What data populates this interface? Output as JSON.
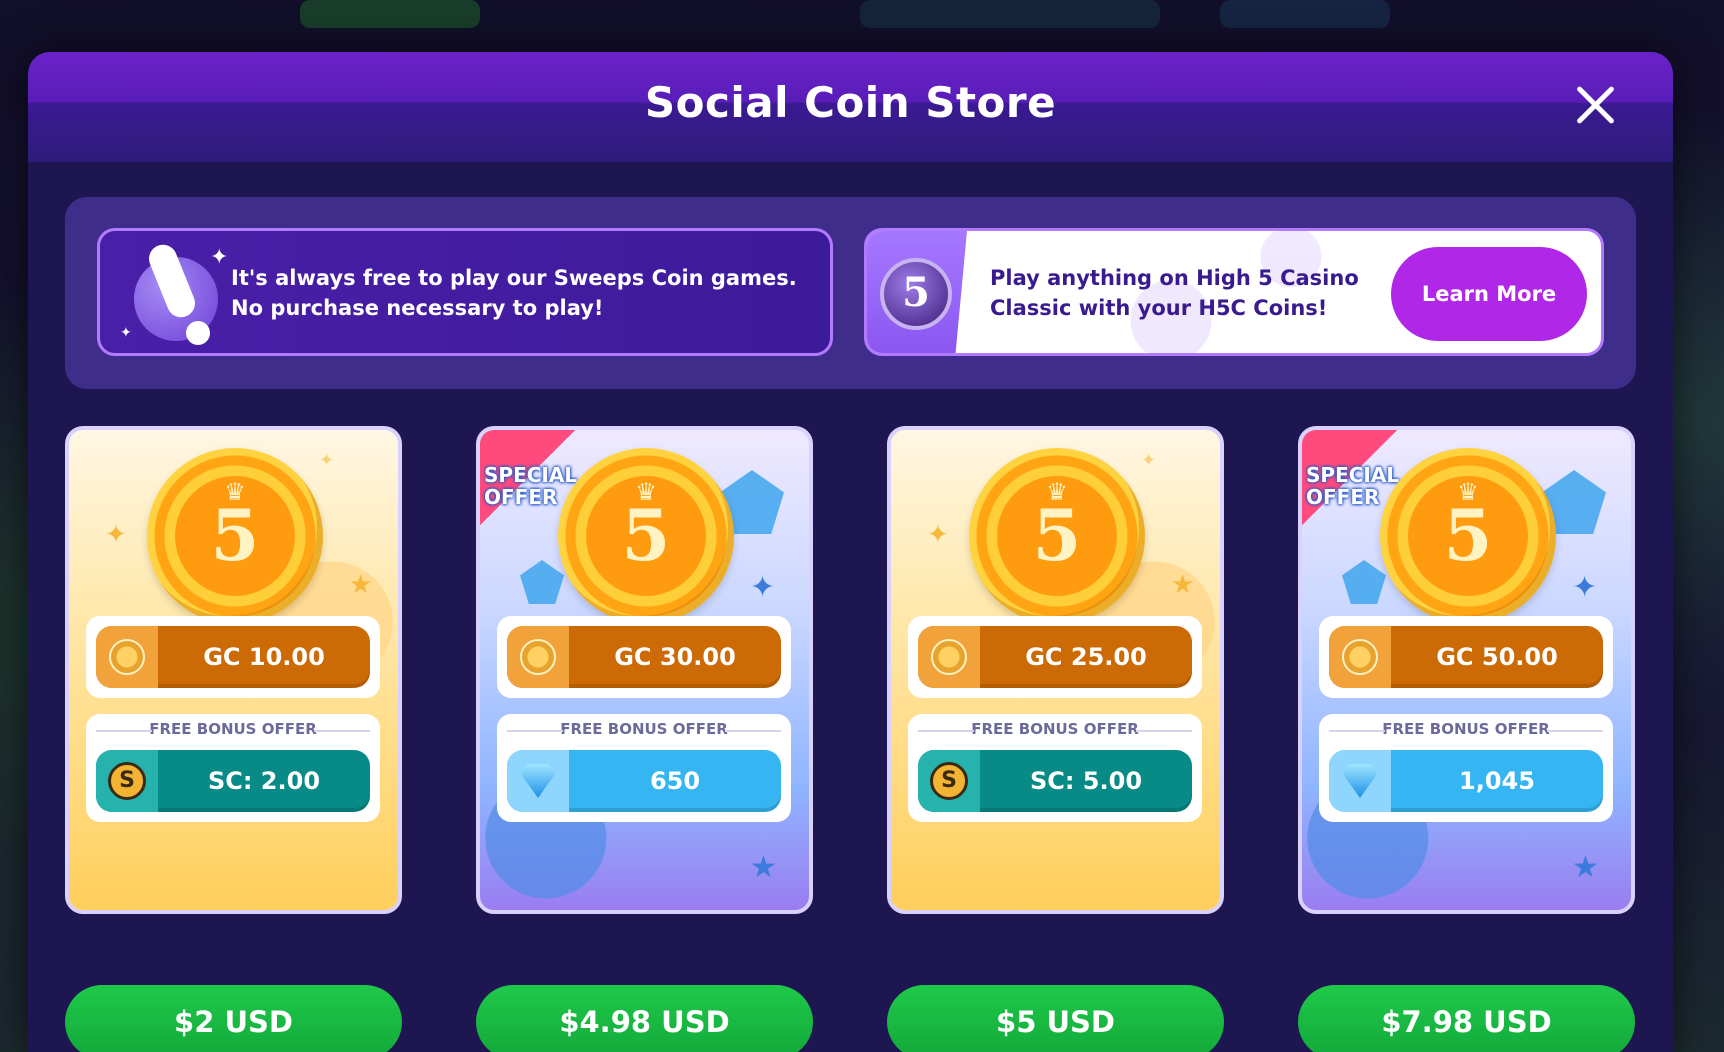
{
  "modal": {
    "title": "Social Coin Store"
  },
  "info_banner": {
    "line1": "It's always free to play our Sweeps Coin games.",
    "line2": "No purchase necessary to play!"
  },
  "h5c_banner": {
    "badge": "5",
    "line1": "Play anything on High 5 Casino",
    "line2": "Classic with your H5C Coins!",
    "button_label": "Learn More"
  },
  "special_offer_label": [
    "SPECIAL",
    "OFFER"
  ],
  "bonus_label": "FREE BONUS OFFER",
  "packages": [
    {
      "style": "gold",
      "special": false,
      "gc": "GC 10.00",
      "bonus_type": "sc",
      "bonus": "SC: 2.00",
      "price": "$2 USD"
    },
    {
      "style": "special",
      "special": true,
      "gc": "GC 30.00",
      "bonus_type": "gem",
      "bonus": "650",
      "price": "$4.98 USD"
    },
    {
      "style": "gold",
      "special": false,
      "gc": "GC 25.00",
      "bonus_type": "sc",
      "bonus": "SC: 5.00",
      "price": "$5 USD"
    },
    {
      "style": "special",
      "special": true,
      "gc": "GC 50.00",
      "bonus_type": "gem",
      "bonus": "1,045",
      "price": "$7.98 USD"
    }
  ],
  "colors": {
    "header_purple": "#6a22c9",
    "modal_bg": "#1d1650",
    "gc_orange": "#cc6a06",
    "sc_teal": "#088a86",
    "gem_blue": "#35b5f2",
    "price_green": "#1fc94a",
    "learn_more": "#b027e8"
  }
}
